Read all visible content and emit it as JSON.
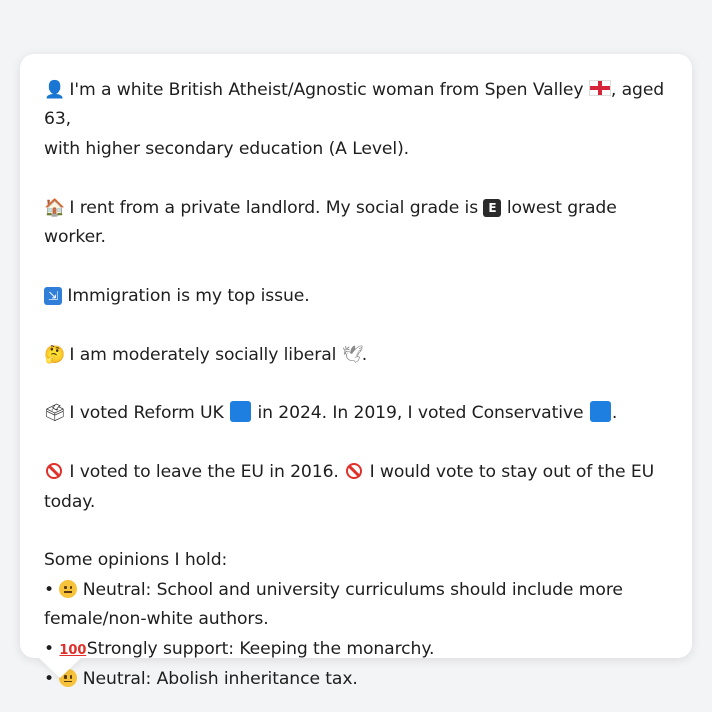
{
  "profile": {
    "intro_a": "I'm a white British Atheist/Agnostic woman from Spen Valley",
    "intro_b": ", aged 63,",
    "intro_c": "with higher secondary education (A Level).",
    "housing_a": "I rent from a private landlord. My social grade is",
    "housing_b": "lowest grade worker.",
    "issue": "Immigration is my top issue.",
    "social_a": "I am moderately socially liberal",
    "social_b": ".",
    "vote_a": "I voted Reform UK",
    "vote_b": "in 2024. In 2019, I voted Conservative",
    "vote_c": ".",
    "eu_a": "I voted to leave the EU in 2016.",
    "eu_b": "I would vote to stay out of the EU",
    "eu_c": "today.",
    "opinions_title": "Some opinions I hold:",
    "opinions": [
      {
        "bullet": "•",
        "stance": "Neutral:",
        "text_a": "School and university curriculums should include more",
        "text_b": "female/non-white authors."
      },
      {
        "bullet": "•",
        "stance": "Strongly support:",
        "text_a": "Keeping the monarchy."
      },
      {
        "bullet": "•",
        "stance": "Neutral:",
        "text_a": "Abolish inheritance tax."
      }
    ],
    "grade_letter": "E",
    "hundred": "100"
  },
  "icons": {
    "person": "bust-in-silhouette-icon",
    "house": "house-icon",
    "immigration": "immigration-icon",
    "thinking": "thinking-face-icon",
    "dove": "dove-icon",
    "ballot": "ballot-box-icon",
    "no_entry": "no-entry-icon",
    "neutral": "neutral-face-icon",
    "hundred": "hundred-points-icon",
    "flag": "england-flag-icon"
  },
  "colors": {
    "reform": "#1f7fe0",
    "conservative": "#1f7fe0",
    "no_entry": "#e0302a"
  }
}
